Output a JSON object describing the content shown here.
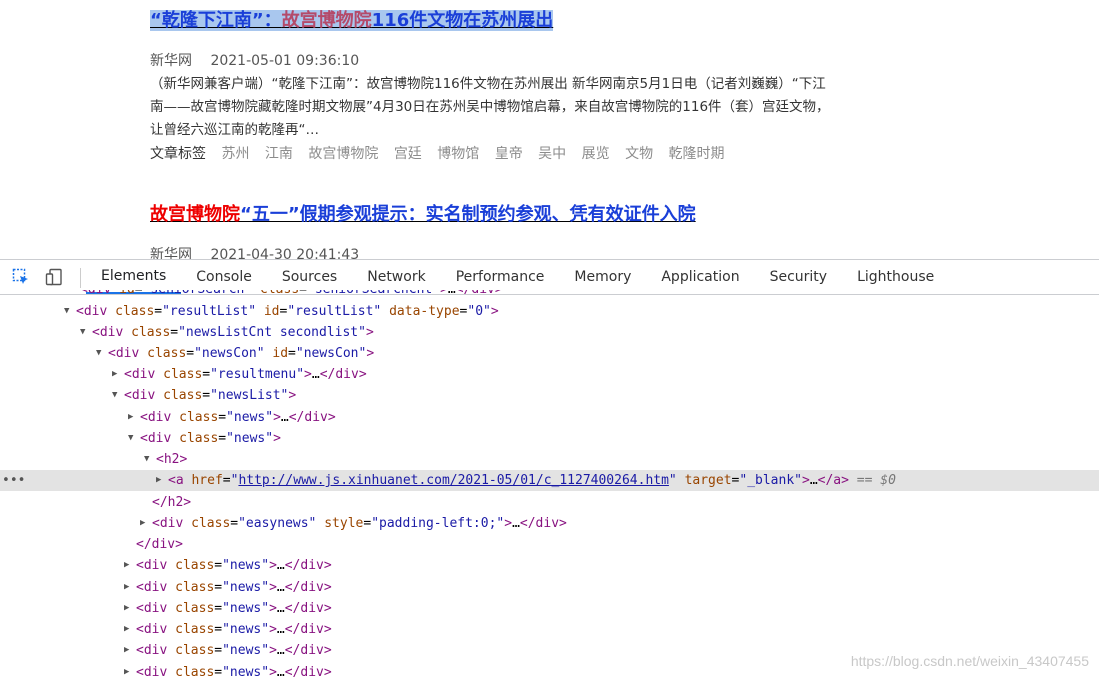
{
  "articles": [
    {
      "title": {
        "pre": "“乾隆下江南”：",
        "hl": "故宫博物院",
        "post": "116件文物在苏州展出"
      },
      "source": "新华网",
      "date": "2021-05-01 09:36:10",
      "summary": "（新华网兼客户端）“乾隆下江南”：故宫博物院116件文物在苏州展出 新华网南京5月1日电（记者刘巍巍）“下江南——故宫博物院藏乾隆时期文物展”4月30日在苏州吴中博物馆启幕，来自故宫博物院的116件（套）宫廷文物，让曾经六巡江南的乾隆再“…",
      "tags_label": "文章标签",
      "tags": [
        "苏州",
        "江南",
        "故宫博物院",
        "宫廷",
        "博物馆",
        "皇帝",
        "吴中",
        "展览",
        "文物",
        "乾隆时期"
      ]
    },
    {
      "title": {
        "hl": "故宫博物院",
        "post": "“五一”假期参观提示：实名制预约参观、凭有效证件入院"
      },
      "source": "新华网",
      "date": "2021-04-30 20:41:43"
    }
  ],
  "devtools": {
    "tabs": [
      "Elements",
      "Console",
      "Sources",
      "Network",
      "Performance",
      "Memory",
      "Application",
      "Security",
      "Lighthouse"
    ],
    "active_tab": "Elements",
    "selected_suffix": "== $0",
    "link_href": "http://www.js.xinhuanet.com/2021-05/01/c_1127400264.htm"
  },
  "watermark": "https://blog.csdn.net/weixin_43407455",
  "colors": {
    "accent": "#1a73e8",
    "title_blue": "#1a3fd8",
    "title_red": "#ee0000"
  }
}
